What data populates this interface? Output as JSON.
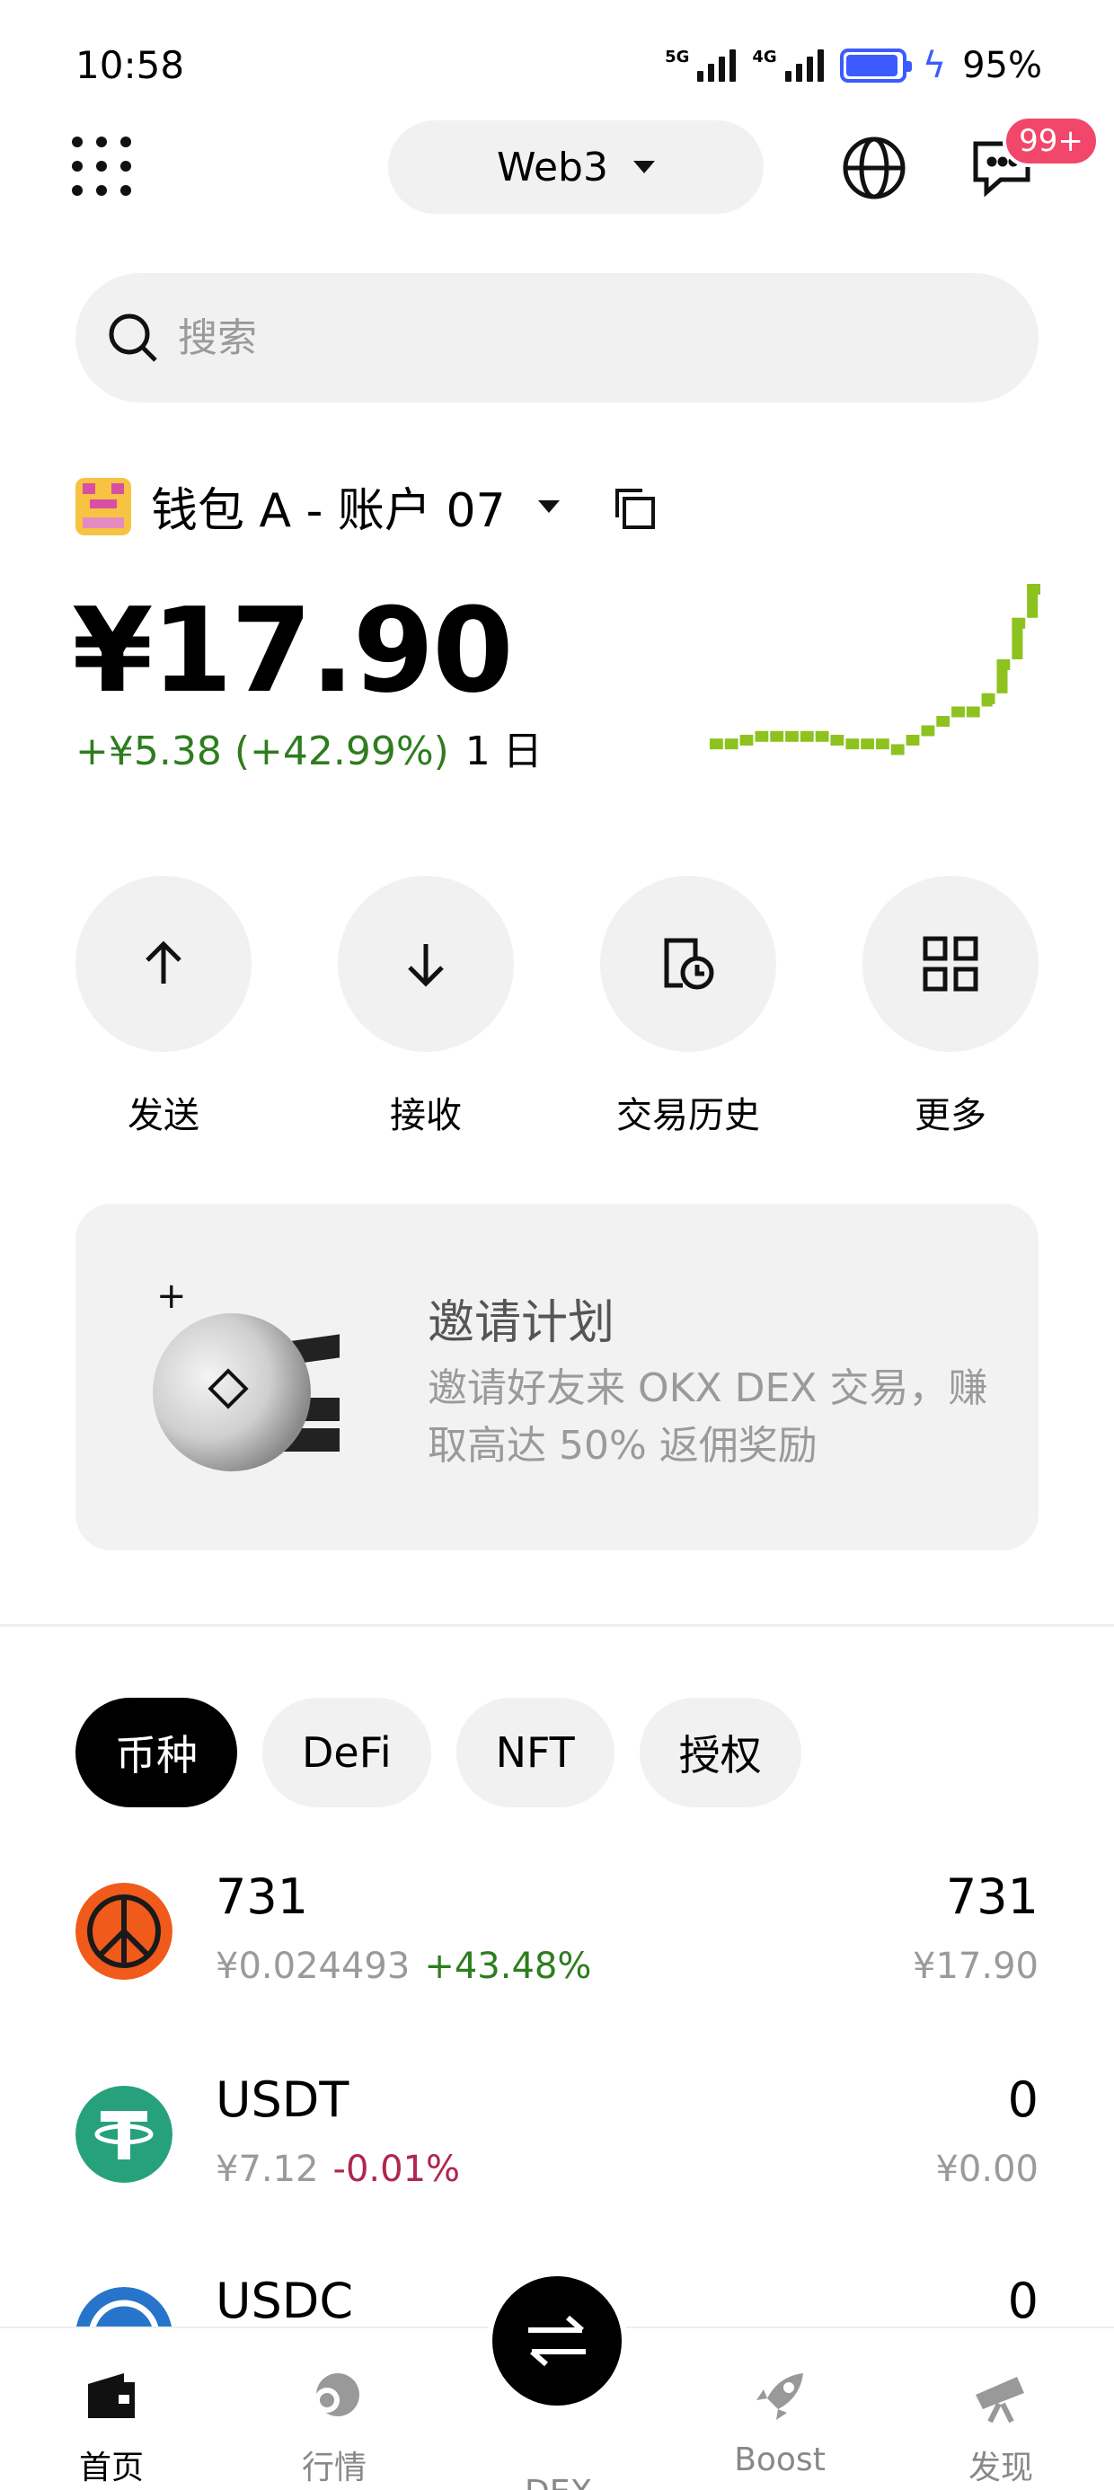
{
  "status_bar": {
    "time": "10:58",
    "signal1_label": "5G",
    "signal2_label": "4G",
    "battery": "95%"
  },
  "header": {
    "network": "Web3",
    "badge": "99+"
  },
  "search": {
    "placeholder": "搜索"
  },
  "wallet": {
    "name": "钱包 A - 账户 07",
    "balance": "¥17.90",
    "change": "+¥5.38 (+42.99%)",
    "period": "1 日",
    "sparkline": [
      0.18,
      0.18,
      0.2,
      0.22,
      0.22,
      0.22,
      0.22,
      0.22,
      0.2,
      0.18,
      0.18,
      0.18,
      0.15,
      0.2,
      0.25,
      0.3,
      0.35,
      0.35,
      0.42,
      0.6,
      0.82,
      1.0
    ]
  },
  "actions": [
    {
      "label": "发送",
      "icon": "arrow-up-icon"
    },
    {
      "label": "接收",
      "icon": "arrow-down-icon"
    },
    {
      "label": "交易历史",
      "icon": "history-icon"
    },
    {
      "label": "更多",
      "icon": "grid-icon"
    }
  ],
  "promo": {
    "title": "邀请计划",
    "desc": "邀请好友来 OKX DEX 交易，赚取高达 50% 返佣奖励"
  },
  "tabs": [
    "币种",
    "DeFi",
    "NFT",
    "授权"
  ],
  "tokens": [
    {
      "name": "731",
      "price": "¥0.024493",
      "change": "+43.48%",
      "amount": "731",
      "value": "¥17.90"
    },
    {
      "name": "USDT",
      "price": "¥7.12",
      "change": "-0.01%",
      "amount": "0",
      "value": "¥0.00"
    },
    {
      "name": "USDC",
      "price": "",
      "change": "",
      "amount": "0",
      "value": ""
    }
  ],
  "nav": [
    {
      "label": "首页",
      "icon": "wallet-icon"
    },
    {
      "label": "行情",
      "icon": "market-icon"
    },
    {
      "label": "DEX",
      "icon": "swap-icon"
    },
    {
      "label": "Boost",
      "icon": "rocket-icon"
    },
    {
      "label": "发现",
      "icon": "telescope-icon"
    }
  ],
  "colors": {
    "positive": "#2e7d1e",
    "negative": "#b0264f",
    "spark": "#8dc21f",
    "badge": "#f2476a"
  }
}
